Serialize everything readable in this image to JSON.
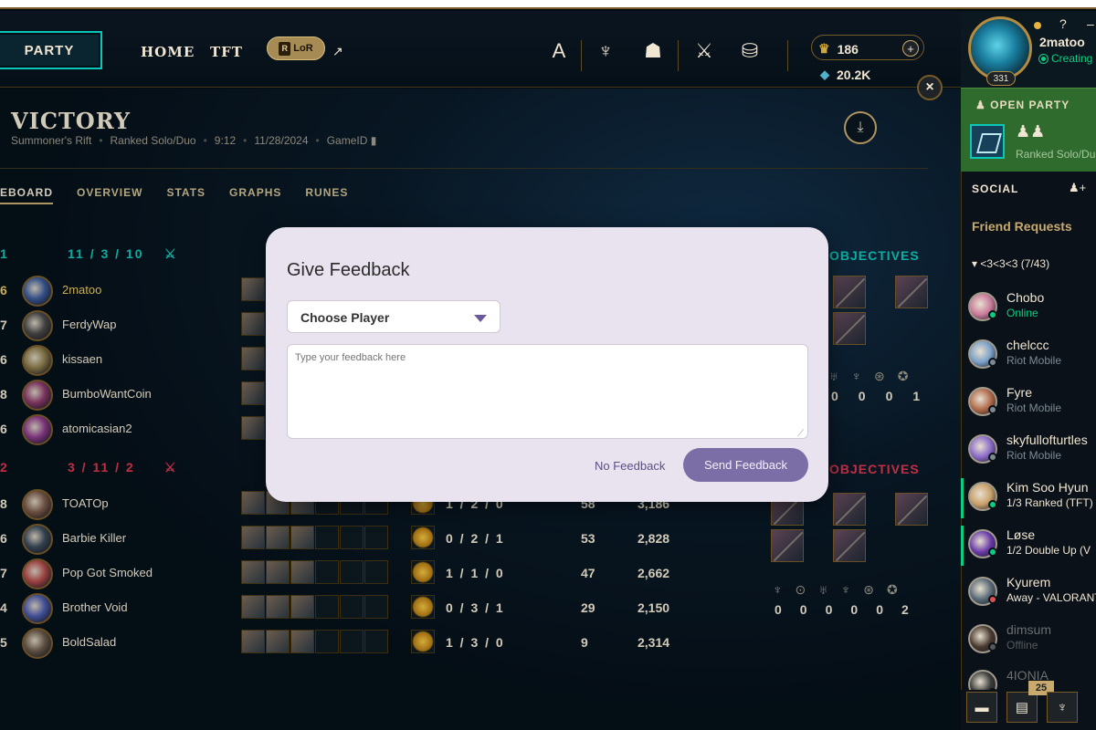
{
  "nav": {
    "party": "PARTY",
    "home": "HOME",
    "tft": "TFT",
    "lor": "LoR",
    "lor_r": "R",
    "ext_arrow": "↗",
    "rp": "186",
    "be": "20.2K",
    "plus": "+",
    "close": "×",
    "icons": [
      "A",
      "♆",
      "☗",
      "⚔",
      "⛁"
    ]
  },
  "profile": {
    "name": "2matoo",
    "status": "Creating",
    "level": "331",
    "help": "?",
    "minimize": "–"
  },
  "party_panel": {
    "title": "OPEN PARTY",
    "members": "♟♟",
    "mode": "Ranked Solo/Du"
  },
  "social": {
    "title": "SOCIAL",
    "add": "♟+",
    "friend_requests": "Friend Requests",
    "group": "▾  <3<3<3 (7/43)",
    "friends": [
      {
        "name": "Chobo",
        "status": "Online",
        "status_color": "#0acf83",
        "avatar": "#c87a9a"
      },
      {
        "name": "chelccc",
        "status": "Riot Mobile",
        "status_color": "#7c8a93",
        "avatar": "#7aa0c8"
      },
      {
        "name": "Fyre",
        "status": "Riot Mobile",
        "status_color": "#7c8a93",
        "avatar": "#b06a4a"
      },
      {
        "name": "skyfullofturtles",
        "status": "Riot Mobile",
        "status_color": "#7c8a93",
        "avatar": "#8a6ac8"
      },
      {
        "name": "Kim Soo Hyun",
        "status": "1/3 Ranked (TFT)",
        "status_color": "#0acf83",
        "avatar": "#c8a06a"
      },
      {
        "name": "Løse",
        "status": "1/2 Double Up (V",
        "status_color": "#0acf83",
        "avatar": "#6a3aa8"
      },
      {
        "name": "Kyurem",
        "status": "Away - VALORANT",
        "status_color": "#e05050",
        "avatar": "#5a6a78"
      },
      {
        "name": "dimsum",
        "status": "Offline",
        "status_color": "#55595b",
        "avatar": "#4a3a30"
      },
      {
        "name": "4IONIA",
        "status": "",
        "status_color": "#55595b",
        "avatar": "#3a3a3a"
      }
    ],
    "notif_count": "25",
    "tools": [
      "▬",
      "▤",
      "♆"
    ]
  },
  "match": {
    "result": "VICTORY",
    "map": "Summoner's Rift",
    "queue": "Ranked Solo/Duo",
    "duration": "9:12",
    "date": "11/28/2024",
    "gameid": "GameID",
    "tabs": [
      "EBOARD",
      "OVERVIEW",
      "STATS",
      "GRAPHS",
      "RUNES"
    ],
    "team1": {
      "label": "1",
      "score": "11 / 3 / 10",
      "color": "#0ac8b9"
    },
    "team2": {
      "label": "2",
      "score": "3 / 11 / 2",
      "color": "#e0344e"
    },
    "objectives_label": "OBJECTIVES",
    "team1_players": [
      {
        "level": "6",
        "name": "2matoo",
        "color": "#3a5a9a"
      },
      {
        "level": "7",
        "name": "FerdyWap",
        "color": "#4a4a4a"
      },
      {
        "level": "6",
        "name": "kissaen",
        "color": "#8a7a4a"
      },
      {
        "level": "8",
        "name": "BumboWantCoin",
        "color": "#8a3a6a"
      },
      {
        "level": "6",
        "name": "atomicasian2",
        "color": "#8a3a8a"
      }
    ],
    "team2_players": [
      {
        "level": "8",
        "name": "TOATOp",
        "kda": "1 / 2 / 0",
        "cs": "58",
        "gold": "3,186",
        "color": "#7a5a4a"
      },
      {
        "level": "6",
        "name": "Barbie Killer",
        "kda": "0 / 2 / 1",
        "cs": "53",
        "gold": "2,828",
        "color": "#3a4a5a"
      },
      {
        "level": "7",
        "name": "Pop Got Smoked",
        "kda": "1 / 1 / 0",
        "cs": "47",
        "gold": "2,662",
        "color": "#b04a4a"
      },
      {
        "level": "4",
        "name": "Brother Void",
        "kda": "0 / 3 / 1",
        "cs": "29",
        "gold": "2,150",
        "color": "#4a5aaa"
      },
      {
        "level": "5",
        "name": "BoldSalad",
        "kda": "1 / 3 / 0",
        "cs": "9",
        "gold": "2,314",
        "color": "#6a5a4a"
      }
    ],
    "obj1_values": [
      "0",
      "0",
      "0",
      "1"
    ],
    "obj2_values": [
      "0",
      "0",
      "0",
      "0",
      "0",
      "2"
    ],
    "obj_icons": [
      "♆",
      "⊙",
      "♅",
      "♆",
      "⊛",
      "✪"
    ]
  },
  "modal": {
    "title": "Give Feedback",
    "select_value": "Choose Player",
    "textarea_placeholder": "Type your feedback here",
    "no_feedback": "No Feedback",
    "send": "Send Feedback"
  }
}
